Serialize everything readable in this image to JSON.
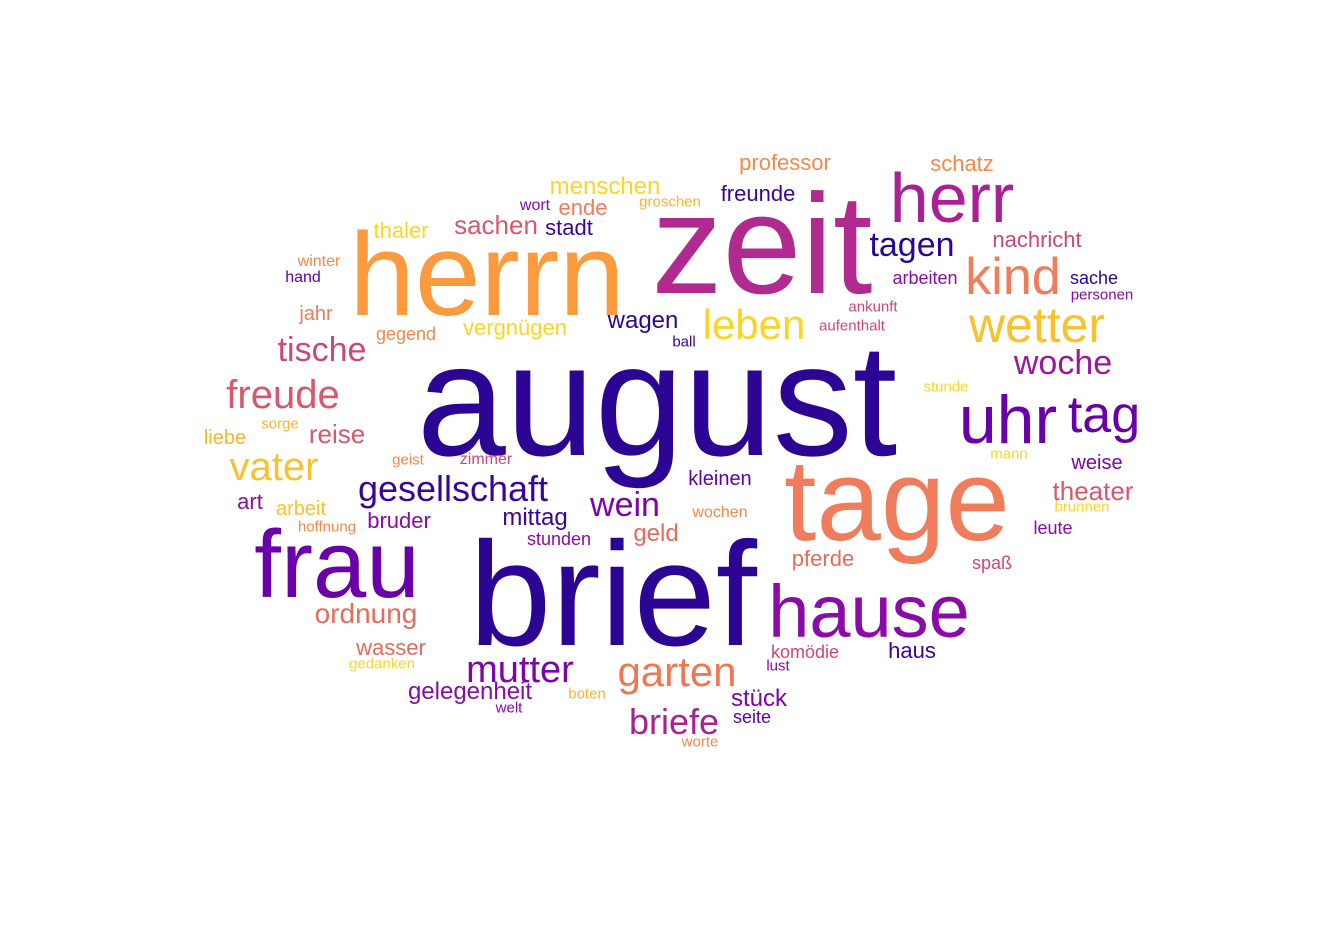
{
  "words": [
    {
      "text": "august",
      "color": "#2c0594"
    },
    {
      "text": "brief",
      "color": "#2c0594"
    },
    {
      "text": "zeit",
      "color": "#b12a90"
    },
    {
      "text": "herrn",
      "color": "#fb9b3d"
    },
    {
      "text": "tage",
      "color": "#ef7c5a"
    },
    {
      "text": "frau",
      "color": "#6a00a8"
    },
    {
      "text": "hause",
      "color": "#8a0ba7"
    },
    {
      "text": "herr",
      "color": "#a82296"
    },
    {
      "text": "uhr",
      "color": "#6a00a8"
    },
    {
      "text": "tag",
      "color": "#6a00a8"
    },
    {
      "text": "kind",
      "color": "#ef7c5a"
    },
    {
      "text": "wetter",
      "color": "#f8c12d"
    },
    {
      "text": "garten",
      "color": "#ed7953"
    },
    {
      "text": "leben",
      "color": "#fbd524"
    },
    {
      "text": "mutter",
      "color": "#7e03a8"
    },
    {
      "text": "vater",
      "color": "#f8c12d"
    },
    {
      "text": "freude",
      "color": "#d8576b"
    },
    {
      "text": "gesellschaft",
      "color": "#3a049a"
    },
    {
      "text": "briefe",
      "color": "#a82296"
    },
    {
      "text": "tagen",
      "color": "#2c0594"
    },
    {
      "text": "woche",
      "color": "#9c179e"
    },
    {
      "text": "tische",
      "color": "#cc4778"
    },
    {
      "text": "wein",
      "color": "#7e03a8"
    },
    {
      "text": "ordnung",
      "color": "#e56b5d"
    },
    {
      "text": "theater",
      "color": "#d8576b"
    },
    {
      "text": "sachen",
      "color": "#d8576b"
    },
    {
      "text": "menschen",
      "color": "#fbd524"
    },
    {
      "text": "herr2",
      "color": "#a82296"
    },
    {
      "text": "professor",
      "color": "#f48849"
    },
    {
      "text": "schatz",
      "color": "#f48849"
    },
    {
      "text": "freunde",
      "color": "#3a049a"
    },
    {
      "text": "nachricht",
      "color": "#cc4778"
    },
    {
      "text": "wagen",
      "color": "#2c0594"
    },
    {
      "text": "vergnügen",
      "color": "#fbd524"
    },
    {
      "text": "mittag",
      "color": "#3a049a"
    },
    {
      "text": "reise",
      "color": "#d8576b"
    },
    {
      "text": "pferde",
      "color": "#e56b5d"
    },
    {
      "text": "geld",
      "color": "#e56b5d"
    },
    {
      "text": "kleinen",
      "color": "#5c01a6"
    },
    {
      "text": "stück",
      "color": "#7e03a8"
    },
    {
      "text": "gelegenheit",
      "color": "#8a0ba7"
    },
    {
      "text": "haus",
      "color": "#3a049a"
    },
    {
      "text": "wasser",
      "color": "#e56b5d"
    },
    {
      "text": "weise",
      "color": "#7e03a8"
    },
    {
      "text": "bruder",
      "color": "#8a0ba7"
    },
    {
      "text": "stadt",
      "color": "#3a049a"
    },
    {
      "text": "thaler",
      "color": "#fbd524"
    },
    {
      "text": "jahr",
      "color": "#ef7c5a"
    },
    {
      "text": "ende",
      "color": "#ef7c5a"
    },
    {
      "text": "sache",
      "color": "#2c0594"
    },
    {
      "text": "arbeiten",
      "color": "#8a0ba7"
    },
    {
      "text": "liebe",
      "color": "#fbb32f"
    },
    {
      "text": "arbeit",
      "color": "#f8c12d"
    },
    {
      "text": "art",
      "color": "#8a0ba7"
    },
    {
      "text": "gegend",
      "color": "#f48849"
    },
    {
      "text": "seite",
      "color": "#5c01a6"
    },
    {
      "text": "stunden",
      "color": "#8a0ba7"
    },
    {
      "text": "komödie",
      "color": "#cc4778"
    },
    {
      "text": "leute",
      "color": "#8a0ba7"
    },
    {
      "text": "spaß",
      "color": "#cc4778"
    },
    {
      "text": "wochen",
      "color": "#f48849"
    },
    {
      "text": "wort",
      "color": "#8a0ba7"
    },
    {
      "text": "groschen",
      "color": "#fbb32f"
    },
    {
      "text": "winter",
      "color": "#f48849"
    },
    {
      "text": "hand",
      "color": "#5c01a6"
    },
    {
      "text": "ankunft",
      "color": "#cc4778"
    },
    {
      "text": "aufenthalt",
      "color": "#cc4778"
    },
    {
      "text": "personen",
      "color": "#8a0ba7"
    },
    {
      "text": "ball",
      "color": "#3a049a"
    },
    {
      "text": "stunde",
      "color": "#fbd524"
    },
    {
      "text": "sorge",
      "color": "#fbb32f"
    },
    {
      "text": "geist",
      "color": "#f48849"
    },
    {
      "text": "zimmer",
      "color": "#cc4778"
    },
    {
      "text": "mann",
      "color": "#fbd524"
    },
    {
      "text": "brunnen",
      "color": "#fbd524"
    },
    {
      "text": "hoffnung",
      "color": "#f48849"
    },
    {
      "text": "gedanken",
      "color": "#fbd524"
    },
    {
      "text": "boten",
      "color": "#fbb32f"
    },
    {
      "text": "lust",
      "color": "#8a0ba7"
    },
    {
      "text": "welt",
      "color": "#8a0ba7"
    },
    {
      "text": "worte",
      "color": "#f48849"
    }
  ]
}
